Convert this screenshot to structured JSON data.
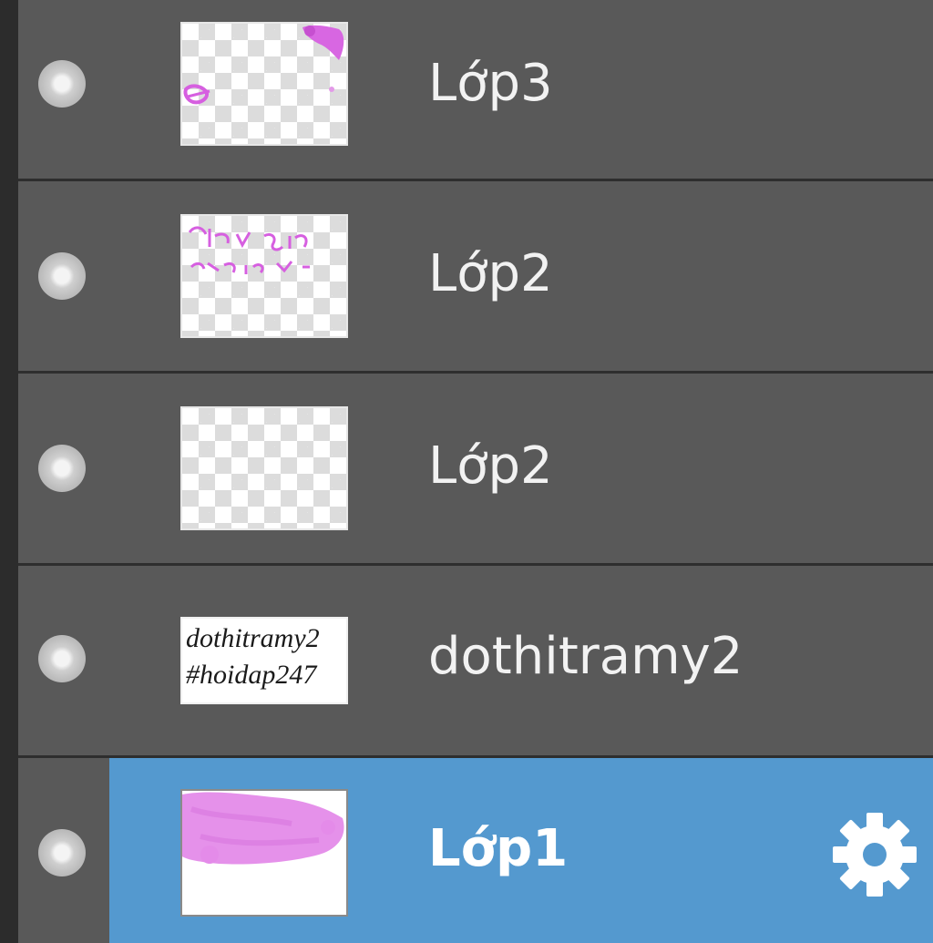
{
  "layers_panel": {
    "layers": [
      {
        "name": "Lớp3",
        "selected": false,
        "thumbnail": "transparent-with-pink-marks"
      },
      {
        "name": "Lớp2",
        "selected": false,
        "thumbnail": "transparent-with-pink-text"
      },
      {
        "name": "Lớp2",
        "selected": false,
        "thumbnail": "transparent-empty"
      },
      {
        "name": "dothitramy2",
        "selected": false,
        "thumbnail": "white-with-black-text"
      },
      {
        "name": "Lớp1",
        "selected": true,
        "thumbnail": "white-with-pink-brush"
      }
    ],
    "thumbnail_texts": {
      "dothitramy2_line1": "dothitramy2",
      "dothitramy2_line2": "#hoidap247"
    },
    "icons": {
      "visibility": "visibility-dot-icon",
      "settings": "gear-icon"
    },
    "colors": {
      "panel_bg": "#595959",
      "selected_bg": "#5499cf",
      "separator": "#2e2e2e",
      "text": "#f2f2f2",
      "pink_marks": "#d65fe0",
      "brush_pink": "#e48be9"
    }
  }
}
